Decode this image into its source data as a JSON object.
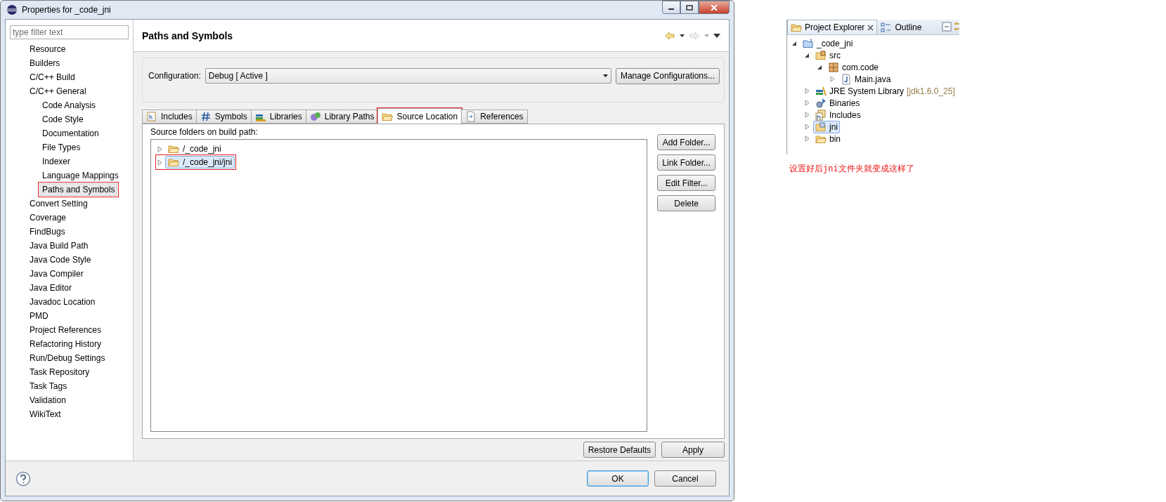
{
  "window": {
    "title": "Properties for _code_jni"
  },
  "sidebar": {
    "filter_placeholder": "type filter text",
    "items": [
      {
        "label": "Resource",
        "selected": false
      },
      {
        "label": "Builders",
        "selected": false
      },
      {
        "label": "C/C++ Build",
        "selected": false
      },
      {
        "label": "C/C++ General",
        "selected": false,
        "children": [
          {
            "label": "Code Analysis",
            "selected": false
          },
          {
            "label": "Code Style",
            "selected": false
          },
          {
            "label": "Documentation",
            "selected": false
          },
          {
            "label": "File Types",
            "selected": false
          },
          {
            "label": "Indexer",
            "selected": false
          },
          {
            "label": "Language Mappings",
            "selected": false
          },
          {
            "label": "Paths and Symbols",
            "selected": true
          }
        ]
      },
      {
        "label": "Convert Setting",
        "selected": false
      },
      {
        "label": "Coverage",
        "selected": false
      },
      {
        "label": "FindBugs",
        "selected": false
      },
      {
        "label": "Java Build Path",
        "selected": false
      },
      {
        "label": "Java Code Style",
        "selected": false
      },
      {
        "label": "Java Compiler",
        "selected": false
      },
      {
        "label": "Java Editor",
        "selected": false
      },
      {
        "label": "Javadoc Location",
        "selected": false
      },
      {
        "label": "PMD",
        "selected": false
      },
      {
        "label": "Project References",
        "selected": false
      },
      {
        "label": "Refactoring History",
        "selected": false
      },
      {
        "label": "Run/Debug Settings",
        "selected": false
      },
      {
        "label": "Task Repository",
        "selected": false
      },
      {
        "label": "Task Tags",
        "selected": false
      },
      {
        "label": "Validation",
        "selected": false
      },
      {
        "label": "WikiText",
        "selected": false
      }
    ]
  },
  "page": {
    "title": "Paths and Symbols",
    "configuration": {
      "label": "Configuration:",
      "value": "Debug  [ Active ]",
      "button": "Manage Configurations..."
    },
    "tabs": [
      {
        "label": "Includes",
        "kind": "includes",
        "selected": false
      },
      {
        "label": "Symbols",
        "kind": "symbols",
        "selected": false
      },
      {
        "label": "Libraries",
        "kind": "libraries",
        "selected": false
      },
      {
        "label": "Library Paths",
        "kind": "librarypaths",
        "selected": false
      },
      {
        "label": "Source Location",
        "kind": "folder",
        "selected": true
      },
      {
        "label": "References",
        "kind": "references",
        "selected": false
      }
    ],
    "panel": {
      "label": "Source folders on build path:",
      "folders": [
        {
          "label": "/_code_jni",
          "selected": false
        },
        {
          "label": "/_code_jni/jni",
          "selected": true
        }
      ],
      "buttons": [
        "Add Folder...",
        "Link Folder...",
        "Edit Filter...",
        "Delete"
      ]
    },
    "actions": [
      "Restore Defaults",
      "Apply"
    ]
  },
  "buttons": [
    {
      "label": "OK",
      "default": true
    },
    {
      "label": "Cancel",
      "default": false
    }
  ],
  "explorer": {
    "tabs": [
      {
        "label": "Project Explorer",
        "selected": true,
        "closable": true
      },
      {
        "label": "Outline",
        "selected": false,
        "closable": false
      }
    ],
    "tree": [
      {
        "label": "_code_jni",
        "kind": "project",
        "expanded": true,
        "selected": false,
        "children": [
          {
            "label": "src",
            "kind": "source",
            "expanded": true,
            "selected": false,
            "children": [
              {
                "label": "com.code",
                "kind": "package",
                "expanded": true,
                "selected": false,
                "children": [
                  {
                    "label": "Main.java",
                    "kind": "java",
                    "expanded": false,
                    "selected": false
                  }
                ]
              }
            ]
          },
          {
            "label": "JRE System Library",
            "suffix": "[jdk1.6.0_25]",
            "kind": "library",
            "expanded": false,
            "selected": false
          },
          {
            "label": "Binaries",
            "kind": "binaries",
            "expanded": false,
            "selected": false
          },
          {
            "label": "Includes",
            "kind": "includes",
            "expanded": false,
            "selected": false
          },
          {
            "label": "jni",
            "kind": "sourcefolder",
            "expanded": false,
            "selected": true
          },
          {
            "label": "bin",
            "kind": "folder",
            "expanded": false,
            "selected": false
          }
        ]
      }
    ]
  },
  "note": "设置好后jni文件夹就变成这样了"
}
